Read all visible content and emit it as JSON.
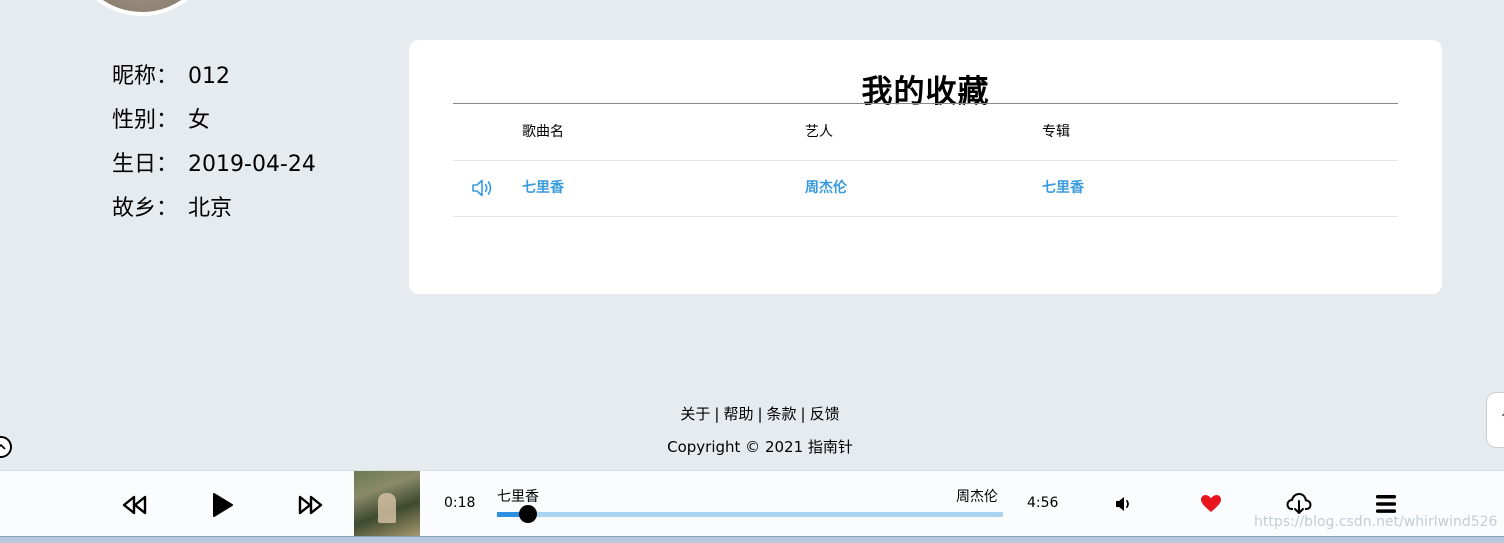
{
  "profile": {
    "nickname_label": "昵称：",
    "nickname": "012",
    "gender_label": "性别：",
    "gender": "女",
    "birthday_label": "生日：",
    "birthday": "2019-04-24",
    "hometown_label": "故乡：",
    "hometown": "北京"
  },
  "favorites": {
    "title": "我的收藏",
    "columns": {
      "song": "歌曲名",
      "artist": "艺人",
      "album": "专辑"
    },
    "rows": [
      {
        "song": "七里香",
        "artist": "周杰伦",
        "album": "七里香",
        "icon": "speaker-icon"
      }
    ]
  },
  "footer": {
    "links": [
      "关于",
      "帮助",
      "条款",
      "反馈"
    ],
    "separator": "|",
    "copyright": "Copyright © 2021 指南针"
  },
  "side_tab": {
    "glyph": "↑"
  },
  "player": {
    "current_time": "0:18",
    "duration": "4:56",
    "title": "七里香",
    "artist": "周杰伦",
    "progress_fraction": 0.061,
    "colors": {
      "progress_fill": "#2c8fe0",
      "progress_track": "#a9d3f1",
      "heart": "#e8141e",
      "link": "#3a9bdc"
    },
    "icons": [
      "rewind-icon",
      "play-icon",
      "fast-forward-icon",
      "volume-icon",
      "heart-icon",
      "cloud-download-icon",
      "menu-icon"
    ]
  },
  "watermark": "https://blog.csdn.net/whirlwind526"
}
